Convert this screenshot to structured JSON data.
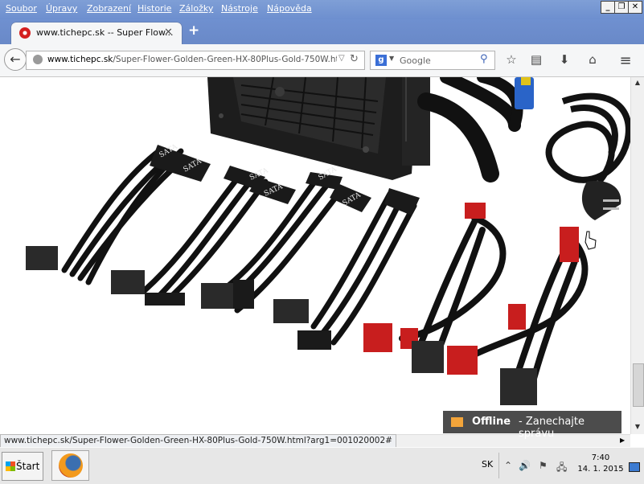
{
  "menu": {
    "items": [
      "Soubor",
      "Úpravy",
      "Zobrazení",
      "Historie",
      "Záložky",
      "Nástroje",
      "Nápověda"
    ]
  },
  "window": {
    "minimize": "_",
    "maximize": "❐",
    "close": "✕"
  },
  "tab": {
    "title": "www.tichepc.sk -- Super Flow...",
    "close": "✕",
    "new": "+"
  },
  "nav": {
    "back": "←",
    "url_domain": "www.tichepc.sk",
    "url_path": "/Super-Flower-Golden-Green-HX-80Plus-Gold-750W.html?...",
    "url_dropdown": "▽",
    "reload": "↻",
    "search_engine": "g",
    "search_dropdown": "▼",
    "search_placeholder": "Google",
    "search_icon": "⚲",
    "bookmark_icon": "☆",
    "library_icon": "▤",
    "download_icon": "⬇",
    "home_icon": "⌂",
    "menu_icon": "≡"
  },
  "status_bar": {
    "url": "www.tichepc.sk/Super-Flower-Golden-Green-HX-80Plus-Gold-750W.html?arg1=001020002#"
  },
  "chat": {
    "status": "Offline",
    "message": "- Zanechajte správu"
  },
  "product_image": {
    "cable_labels": [
      "SATA",
      "SATA",
      "SATA",
      "SATA",
      "SATA",
      "SATA"
    ],
    "colors": {
      "cable": "#121212",
      "connector": "#c81e1e",
      "connector_blue": "#2a64c8"
    }
  },
  "taskbar": {
    "start_label": "Štart",
    "language": "SK",
    "clock_time": "7:40",
    "clock_date": "14. 1. 2015",
    "tray_up": "⌃",
    "tray_volume": "🔊",
    "tray_flag": "⚑",
    "tray_network": "🖧"
  }
}
